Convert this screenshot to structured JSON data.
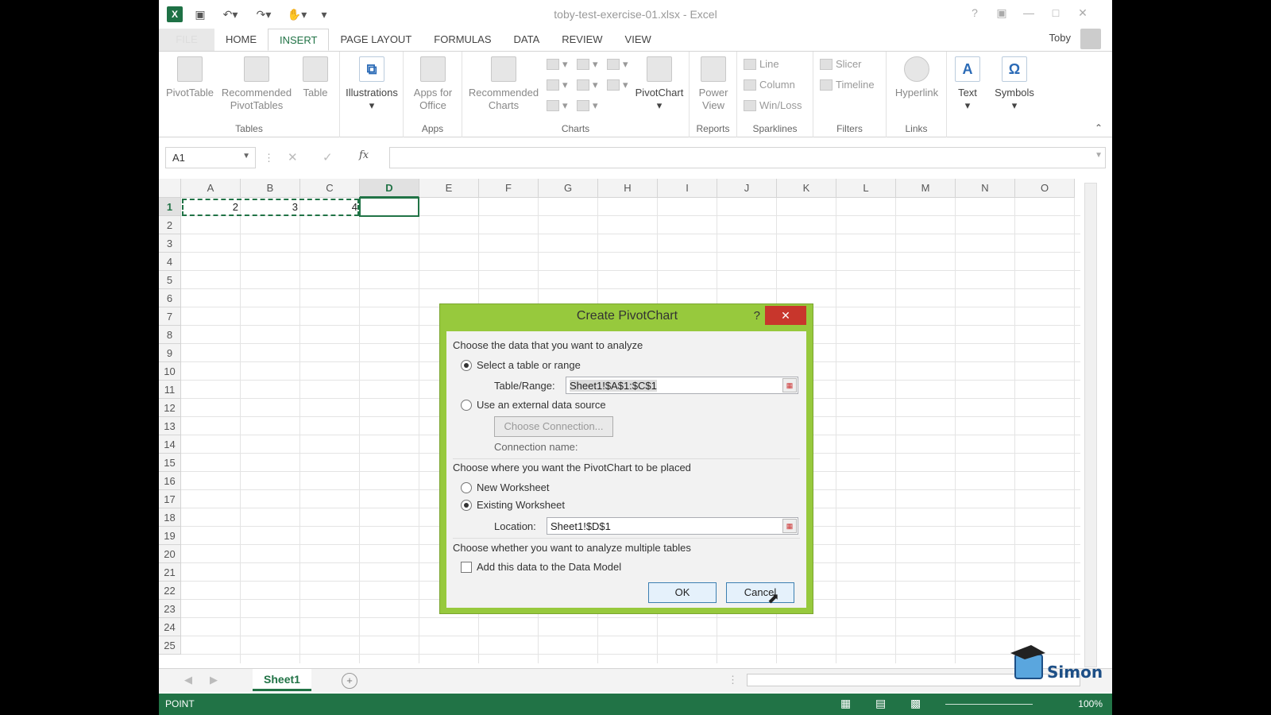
{
  "app": {
    "title": "toby-test-exercise-01.xlsx - Excel",
    "logo": "X",
    "user": "Toby",
    "window_help": "?"
  },
  "tabs": [
    "FILE",
    "HOME",
    "INSERT",
    "PAGE LAYOUT",
    "FORMULAS",
    "DATA",
    "REVIEW",
    "VIEW"
  ],
  "ribbon": {
    "tables": {
      "label": "Tables",
      "pivottable": "PivotTable",
      "recommended_pivot": "Recommended PivotTables",
      "table": "Table"
    },
    "illustrations": {
      "label": "Illustrations"
    },
    "apps": {
      "label": "Apps",
      "apps_for_office": "Apps for Office"
    },
    "charts": {
      "label": "Charts",
      "recommended_charts": "Recommended Charts",
      "pivotchart": "PivotChart"
    },
    "reports": {
      "label": "Reports",
      "power_view": "Power View"
    },
    "sparklines": {
      "label": "Sparklines",
      "line": "Line",
      "column": "Column",
      "winloss": "Win/Loss"
    },
    "filters": {
      "label": "Filters",
      "slicer": "Slicer",
      "timeline": "Timeline"
    },
    "links": {
      "label": "Links",
      "hyperlink": "Hyperlink"
    },
    "text": {
      "label": "Text"
    },
    "symbols": {
      "label": "Symbols"
    }
  },
  "formula_bar": {
    "name_box": "A1",
    "fx": "fx",
    "formula": ""
  },
  "grid": {
    "columns": [
      "A",
      "B",
      "C",
      "D",
      "E",
      "F",
      "G",
      "H",
      "I",
      "J",
      "K",
      "L",
      "M",
      "N",
      "O"
    ],
    "rows": [
      "1",
      "2",
      "3",
      "4",
      "5",
      "6",
      "7",
      "8",
      "9",
      "10",
      "11",
      "12",
      "13",
      "14",
      "15",
      "16",
      "17",
      "18",
      "19",
      "20",
      "21",
      "22",
      "23",
      "24",
      "25"
    ],
    "cells": {
      "A1": "2",
      "B1": "3",
      "C1": "4"
    }
  },
  "sheets": {
    "active": "Sheet1",
    "add": "+"
  },
  "status": {
    "mode": "POINT",
    "zoom": "100%"
  },
  "dialog": {
    "title": "Create PivotChart",
    "help": "?",
    "close": "✕",
    "section1": "Choose the data that you want to analyze",
    "opt_table": "Select a table or range",
    "table_range_label": "Table/Range:",
    "table_range_value": "Sheet1!$A$1:$C$1",
    "opt_external": "Use an external data source",
    "choose_connection": "Choose Connection...",
    "connection_name": "Connection name:",
    "section2": "Choose where you want the PivotChart to be placed",
    "opt_new": "New Worksheet",
    "opt_existing": "Existing Worksheet",
    "location_label": "Location:",
    "location_value": "Sheet1!$D$1",
    "section3": "Choose whether you want to analyze multiple tables",
    "data_model": "Add this data to the Data Model",
    "ok": "OK",
    "cancel": "Cancel"
  },
  "branding": {
    "logo_text": "Simon"
  }
}
